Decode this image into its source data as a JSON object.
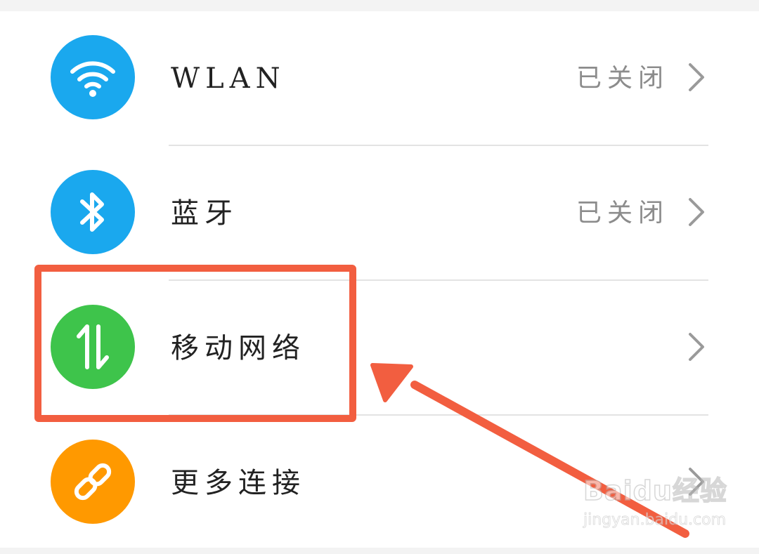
{
  "settings_list": [
    {
      "id": "wlan",
      "label": "WLAN",
      "status": "已关闭",
      "icon": "wifi-icon",
      "icon_color": "#1aa8ee"
    },
    {
      "id": "bluetooth",
      "label": "蓝牙",
      "status": "已关闭",
      "icon": "bluetooth-icon",
      "icon_color": "#1aa8ee"
    },
    {
      "id": "mobile-network",
      "label": "移动网络",
      "status": "",
      "icon": "mobile-data-icon",
      "icon_color": "#3ec44b"
    },
    {
      "id": "more-connections",
      "label": "更多连接",
      "status": "",
      "icon": "link-icon",
      "icon_color": "#ff9900"
    }
  ],
  "annotation": {
    "highlight_color": "#f25e40",
    "highlighted_item": "mobile-network"
  },
  "watermark": {
    "logo": "Baidu经验",
    "url": "jingyan.baidu.com"
  },
  "colors": {
    "background": "#f3f3f3",
    "panel": "#ffffff",
    "divider": "#e3e3e3",
    "label_text": "#222222",
    "status_text": "#8c8c8c",
    "chevron": "#9a9a9a"
  }
}
